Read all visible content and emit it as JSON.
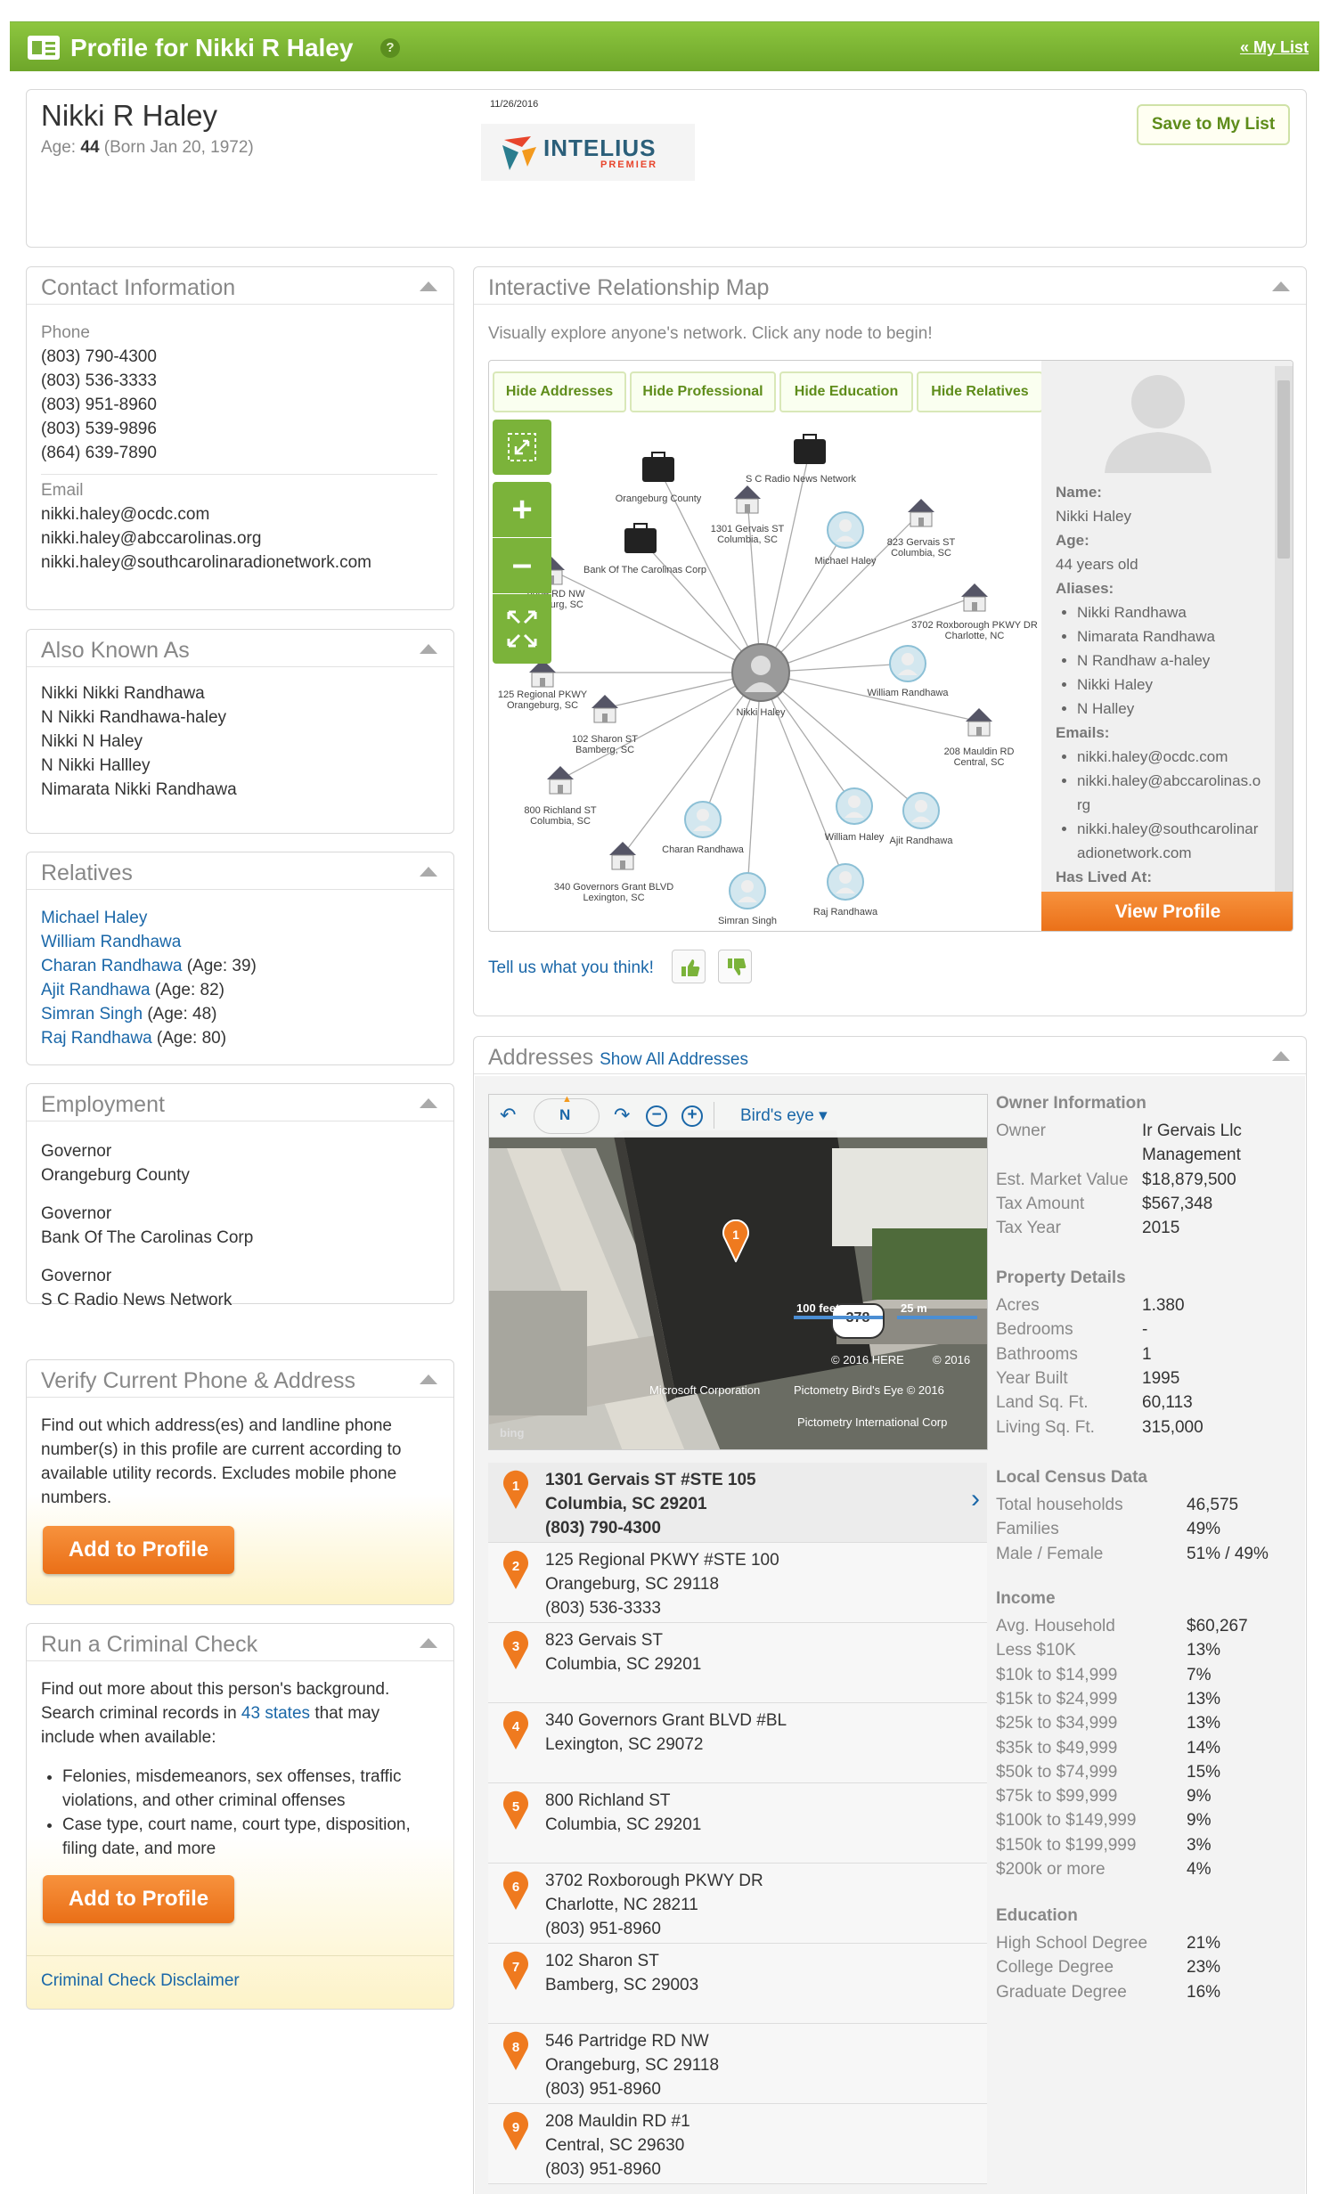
{
  "header": {
    "title": "Profile for Nikki R Haley",
    "help": "?",
    "my_list": "« My List"
  },
  "profile": {
    "name": "Nikki R Haley",
    "age_label": "Age:",
    "age": "44",
    "born": "(Born Jan 20, 1972)",
    "date": "11/26/2016",
    "logo_main": "INTELIUS",
    "logo_sub": "PREMIER",
    "save_button": "Save to My List"
  },
  "contact": {
    "title": "Contact Information",
    "phone_label": "Phone",
    "phones": [
      "(803) 790-4300",
      "(803) 536-3333",
      "(803) 951-8960",
      "(803) 539-9896",
      "(864) 639-7890"
    ],
    "email_label": "Email",
    "emails": [
      "nikki.haley@ocdc.com",
      "nikki.haley@abccarolinas.org",
      "nikki.haley@southcarolinaradionetwork.com"
    ]
  },
  "aka": {
    "title": "Also Known As",
    "names": [
      "Nikki Nikki Randhawa",
      "N Nikki Randhawa-haley",
      "Nikki N Haley",
      "N Nikki Hallley",
      "Nimarata Nikki Randhawa"
    ]
  },
  "relatives": {
    "title": "Relatives",
    "people": [
      {
        "name": "Michael Haley",
        "age": ""
      },
      {
        "name": "William Randhawa",
        "age": ""
      },
      {
        "name": "Charan Randhawa",
        "age": "(Age: 39)"
      },
      {
        "name": "Ajit Randhawa",
        "age": "(Age: 82)"
      },
      {
        "name": "Simran Singh",
        "age": "(Age: 48)"
      },
      {
        "name": "Raj Randhawa",
        "age": "(Age: 80)"
      }
    ]
  },
  "employment": {
    "title": "Employment",
    "jobs": [
      {
        "role": "Governor",
        "org": "Orangeburg County"
      },
      {
        "role": "Governor",
        "org": "Bank Of The Carolinas Corp"
      },
      {
        "role": "Governor",
        "org": "S C Radio News Network"
      }
    ]
  },
  "verify": {
    "title": "Verify Current Phone & Address",
    "text": "Find out which address(es) and landline phone number(s) in this profile are current according to available utility records. Excludes mobile phone numbers.",
    "button": "Add to Profile"
  },
  "criminal": {
    "title": "Run a Criminal Check",
    "text1": "Find out more about this person's background. Search criminal records in",
    "states": "43 states",
    "text2": "that may include when available:",
    "bullets": [
      "Felonies, misdemeanors, sex offenses, traffic violations, and other criminal offenses",
      "Case type, court name, court type, disposition, filing date, and more"
    ],
    "button": "Add to Profile",
    "disclaimer": "Criminal Check Disclaimer"
  },
  "map": {
    "title": "Interactive Relationship Map",
    "subtitle": "Visually explore anyone's network. Click any node to begin!",
    "tabs": [
      "Hide Addresses",
      "Hide Professional",
      "Hide Education",
      "Hide Relatives"
    ],
    "center": "Nikki Haley",
    "nodes": [
      {
        "label": "Orangeburg County",
        "type": "work"
      },
      {
        "label": "S C Radio News Network",
        "type": "work"
      },
      {
        "label": "1301 Gervais ST\nColumbia, SC",
        "type": "house"
      },
      {
        "label": "Michael Haley",
        "type": "person"
      },
      {
        "label": "823 Gervais ST\nColumbia, SC",
        "type": "house"
      },
      {
        "label": "Bank Of The Carolinas Corp",
        "type": "work"
      },
      {
        "label": "ridge RD NW\nngeburg, SC",
        "type": "house"
      },
      {
        "label": "3702 Roxborough PKWY DR\nCharlotte, NC",
        "type": "house"
      },
      {
        "label": "William Randhawa",
        "type": "person"
      },
      {
        "label": "125 Regional PKWY\nOrangeburg, SC",
        "type": "house"
      },
      {
        "label": "102 Sharon ST\nBamberg, SC",
        "type": "house"
      },
      {
        "label": "208 Mauldin RD\nCentral, SC",
        "type": "house"
      },
      {
        "label": "800 Richland ST\nColumbia, SC",
        "type": "house"
      },
      {
        "label": "Charan Randhawa",
        "type": "person"
      },
      {
        "label": "William Haley",
        "type": "person"
      },
      {
        "label": "Ajit Randhawa",
        "type": "person"
      },
      {
        "label": "340 Governors Grant BLVD\nLexington, SC",
        "type": "house"
      },
      {
        "label": "Simran Singh",
        "type": "person"
      },
      {
        "label": "Raj Randhawa",
        "type": "person"
      }
    ],
    "side": {
      "name_label": "Name:",
      "name": "Nikki Haley",
      "age_label": "Age:",
      "age": "44 years old",
      "aliases_label": "Aliases:",
      "aliases": [
        "Nikki Randhawa",
        "Nimarata Randhawa",
        "N Randhaw a-haley",
        "Nikki Haley",
        "N Halley"
      ],
      "emails_label": "Emails:",
      "emails": [
        "nikki.haley@ocdc.com",
        "nikki.haley@abccarolinas.o rg",
        "nikki.haley@southcarolinar adionetwork.com"
      ],
      "lived_label": "Has Lived At:",
      "view_button": "View Profile"
    },
    "feedback": "Tell us what you think!"
  },
  "addresses": {
    "title": "Addresses",
    "show_all": "Show All Addresses",
    "map_mode": "Bird's eye",
    "map_credits": [
      "100 feet",
      "25 m",
      "© 2016 HERE",
      "© 2016",
      "Microsoft Corporation",
      "Pictometry Bird's Eye © 2016",
      "Pictometry International Corp",
      "bing"
    ],
    "shield": "378",
    "list": [
      {
        "n": "1",
        "l1": "1301 Gervais ST #STE 105",
        "l2": "Columbia, SC 29201",
        "l3": "(803) 790-4300"
      },
      {
        "n": "2",
        "l1": "125 Regional PKWY #STE 100",
        "l2": "Orangeburg, SC 29118",
        "l3": "(803) 536-3333"
      },
      {
        "n": "3",
        "l1": "823 Gervais ST",
        "l2": "Columbia, SC 29201",
        "l3": ""
      },
      {
        "n": "4",
        "l1": "340 Governors Grant BLVD #BL",
        "l2": "Lexington, SC 29072",
        "l3": ""
      },
      {
        "n": "5",
        "l1": "800 Richland ST",
        "l2": "Columbia, SC 29201",
        "l3": ""
      },
      {
        "n": "6",
        "l1": "3702 Roxborough PKWY DR",
        "l2": "Charlotte, NC 28211",
        "l3": "(803) 951-8960"
      },
      {
        "n": "7",
        "l1": "102 Sharon ST",
        "l2": "Bamberg, SC 29003",
        "l3": ""
      },
      {
        "n": "8",
        "l1": "546 Partridge RD NW",
        "l2": "Orangeburg, SC 29118",
        "l3": "(803) 951-8960"
      },
      {
        "n": "9",
        "l1": "208 Mauldin RD #1",
        "l2": "Central, SC 29630",
        "l3": "(803) 951-8960"
      }
    ]
  },
  "owner": {
    "title": "Owner Information",
    "rows": [
      [
        "Owner",
        "Ir Gervais Llc"
      ],
      [
        "",
        "Management"
      ],
      [
        "Est. Market Value",
        "$18,879,500"
      ],
      [
        "Tax Amount",
        "$567,348"
      ],
      [
        "Tax Year",
        "2015"
      ]
    ]
  },
  "property": {
    "title": "Property Details",
    "rows": [
      [
        "Acres",
        "1.380"
      ],
      [
        "Bedrooms",
        "-"
      ],
      [
        "Bathrooms",
        "1"
      ],
      [
        "Year Built",
        "1995"
      ],
      [
        "Land Sq. Ft.",
        "60,113"
      ],
      [
        "Living Sq. Ft.",
        "315,000"
      ]
    ]
  },
  "census": {
    "title": "Local Census Data",
    "rows": [
      [
        "Total households",
        "46,575"
      ],
      [
        "Families",
        "49%"
      ],
      [
        "Male / Female",
        "51% / 49%"
      ]
    ]
  },
  "income": {
    "title": "Income",
    "rows": [
      [
        "Avg. Household",
        "$60,267"
      ],
      [
        "Less $10K",
        "13%"
      ],
      [
        "$10k to $14,999",
        "7%"
      ],
      [
        "$15k to $24,999",
        "13%"
      ],
      [
        "$25k to $34,999",
        "13%"
      ],
      [
        "$35k to $49,999",
        "14%"
      ],
      [
        "$50k to $74,999",
        "15%"
      ],
      [
        "$75k to $99,999",
        "9%"
      ],
      [
        "$100k to $149,999",
        "9%"
      ],
      [
        "$150k to $199,999",
        "3%"
      ],
      [
        "$200k or more",
        "4%"
      ]
    ]
  },
  "education": {
    "title": "Education",
    "rows": [
      [
        "High School Degree",
        "21%"
      ],
      [
        "College Degree",
        "23%"
      ],
      [
        "Graduate Degree",
        "16%"
      ]
    ]
  },
  "colors": {
    "green": "#7bb33a",
    "orange": "#ef7a1f",
    "link": "#1a67a8"
  }
}
